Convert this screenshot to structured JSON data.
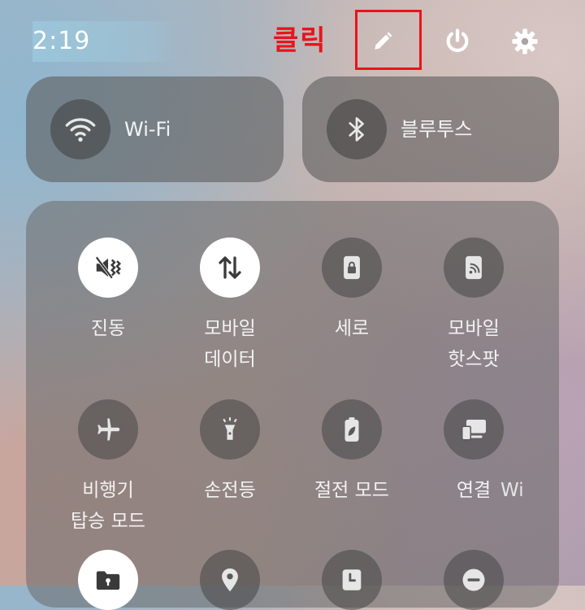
{
  "status_bar": {
    "time": "2:19",
    "annotation": "클릭"
  },
  "top_buttons": [
    {
      "name": "edit",
      "icon": "pencil-icon"
    },
    {
      "name": "power",
      "icon": "power-icon"
    },
    {
      "name": "settings",
      "icon": "gear-icon"
    }
  ],
  "wide_tiles": {
    "wifi": {
      "label": "Wi-Fi",
      "icon": "wifi-icon"
    },
    "bluetooth": {
      "label": "블루투스",
      "icon": "bluetooth-icon"
    }
  },
  "tiles": [
    {
      "label": "진동",
      "icon": "vibrate-mute-icon",
      "active": true
    },
    {
      "label": "모바일\n데이터",
      "icon": "mobile-data-icon",
      "active": true
    },
    {
      "label": "세로",
      "icon": "portrait-lock-icon",
      "active": false
    },
    {
      "label": "모바일\n핫스팟",
      "icon": "hotspot-icon",
      "active": false
    },
    {
      "label": "비행기\n탑승 모드",
      "icon": "airplane-icon",
      "active": false
    },
    {
      "label": "손전등",
      "icon": "flashlight-icon",
      "active": false
    },
    {
      "label": "절전 모드",
      "icon": "battery-saver-icon",
      "active": false
    },
    {
      "label": "연결",
      "icon": "connected-devices-icon",
      "active": false
    },
    {
      "label": "",
      "icon": "secure-folder-icon",
      "active": true
    },
    {
      "label": "",
      "icon": "location-icon",
      "active": false
    },
    {
      "label": "",
      "icon": "clock-icon",
      "active": false
    },
    {
      "label": "",
      "icon": "do-not-disturb-icon",
      "active": false
    }
  ],
  "partial_tile_label": "Wi",
  "colors": {
    "highlight": "#e8141c",
    "tile_on": "#ffffff",
    "icon_dark": "#3a3a3a"
  }
}
